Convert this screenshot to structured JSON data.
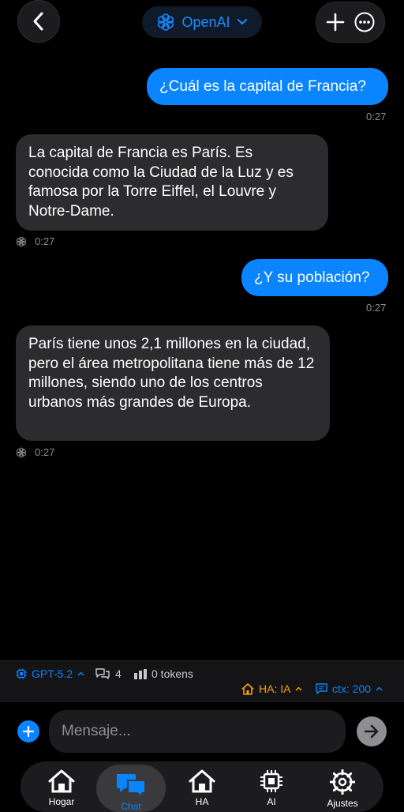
{
  "header": {
    "back_icon": "chevron-left-icon",
    "provider_label": "OpenAI",
    "provider_icon": "openai-logo-icon",
    "new_chat_icon": "plus-icon",
    "more_icon": "ellipsis-circle-icon"
  },
  "messages": [
    {
      "role": "user",
      "text": "¿Cuál es la capital de Francia?",
      "time": "0:27"
    },
    {
      "role": "assistant",
      "text": "La capital de Francia es París. Es conocida como la Ciudad de la Luz y es famosa por la Torre Eiffel, el Louvre y Notre-Dame.",
      "time": "0:27"
    },
    {
      "role": "user",
      "text": "¿Y su población?",
      "time": "0:27"
    },
    {
      "role": "assistant",
      "text": "París tiene unos 2,1 millones en la ciudad, pero el área metropolitana tiene más de 12 millones, siendo uno de los centros urbanos más grandes de Europa.",
      "time": "0:27"
    }
  ],
  "status": {
    "model": "GPT-5.2",
    "message_count": "4",
    "tokens": "0 tokens",
    "ha_mode": "HA: IA",
    "ctx": "ctx: 200"
  },
  "composer": {
    "placeholder": "Mensaje..."
  },
  "tabs": [
    {
      "label": "Hogar",
      "icon": "home-icon"
    },
    {
      "label": "Chat",
      "icon": "chat-bubbles-icon"
    },
    {
      "label": "HA",
      "icon": "home-icon"
    },
    {
      "label": "AI",
      "icon": "chip-icon"
    },
    {
      "label": "Ajustes",
      "icon": "gear-icon"
    }
  ],
  "colors": {
    "accent": "#0a84ff",
    "orange": "#ff9f0a",
    "bubble_ai": "#2c2c2e",
    "background": "#000000"
  }
}
